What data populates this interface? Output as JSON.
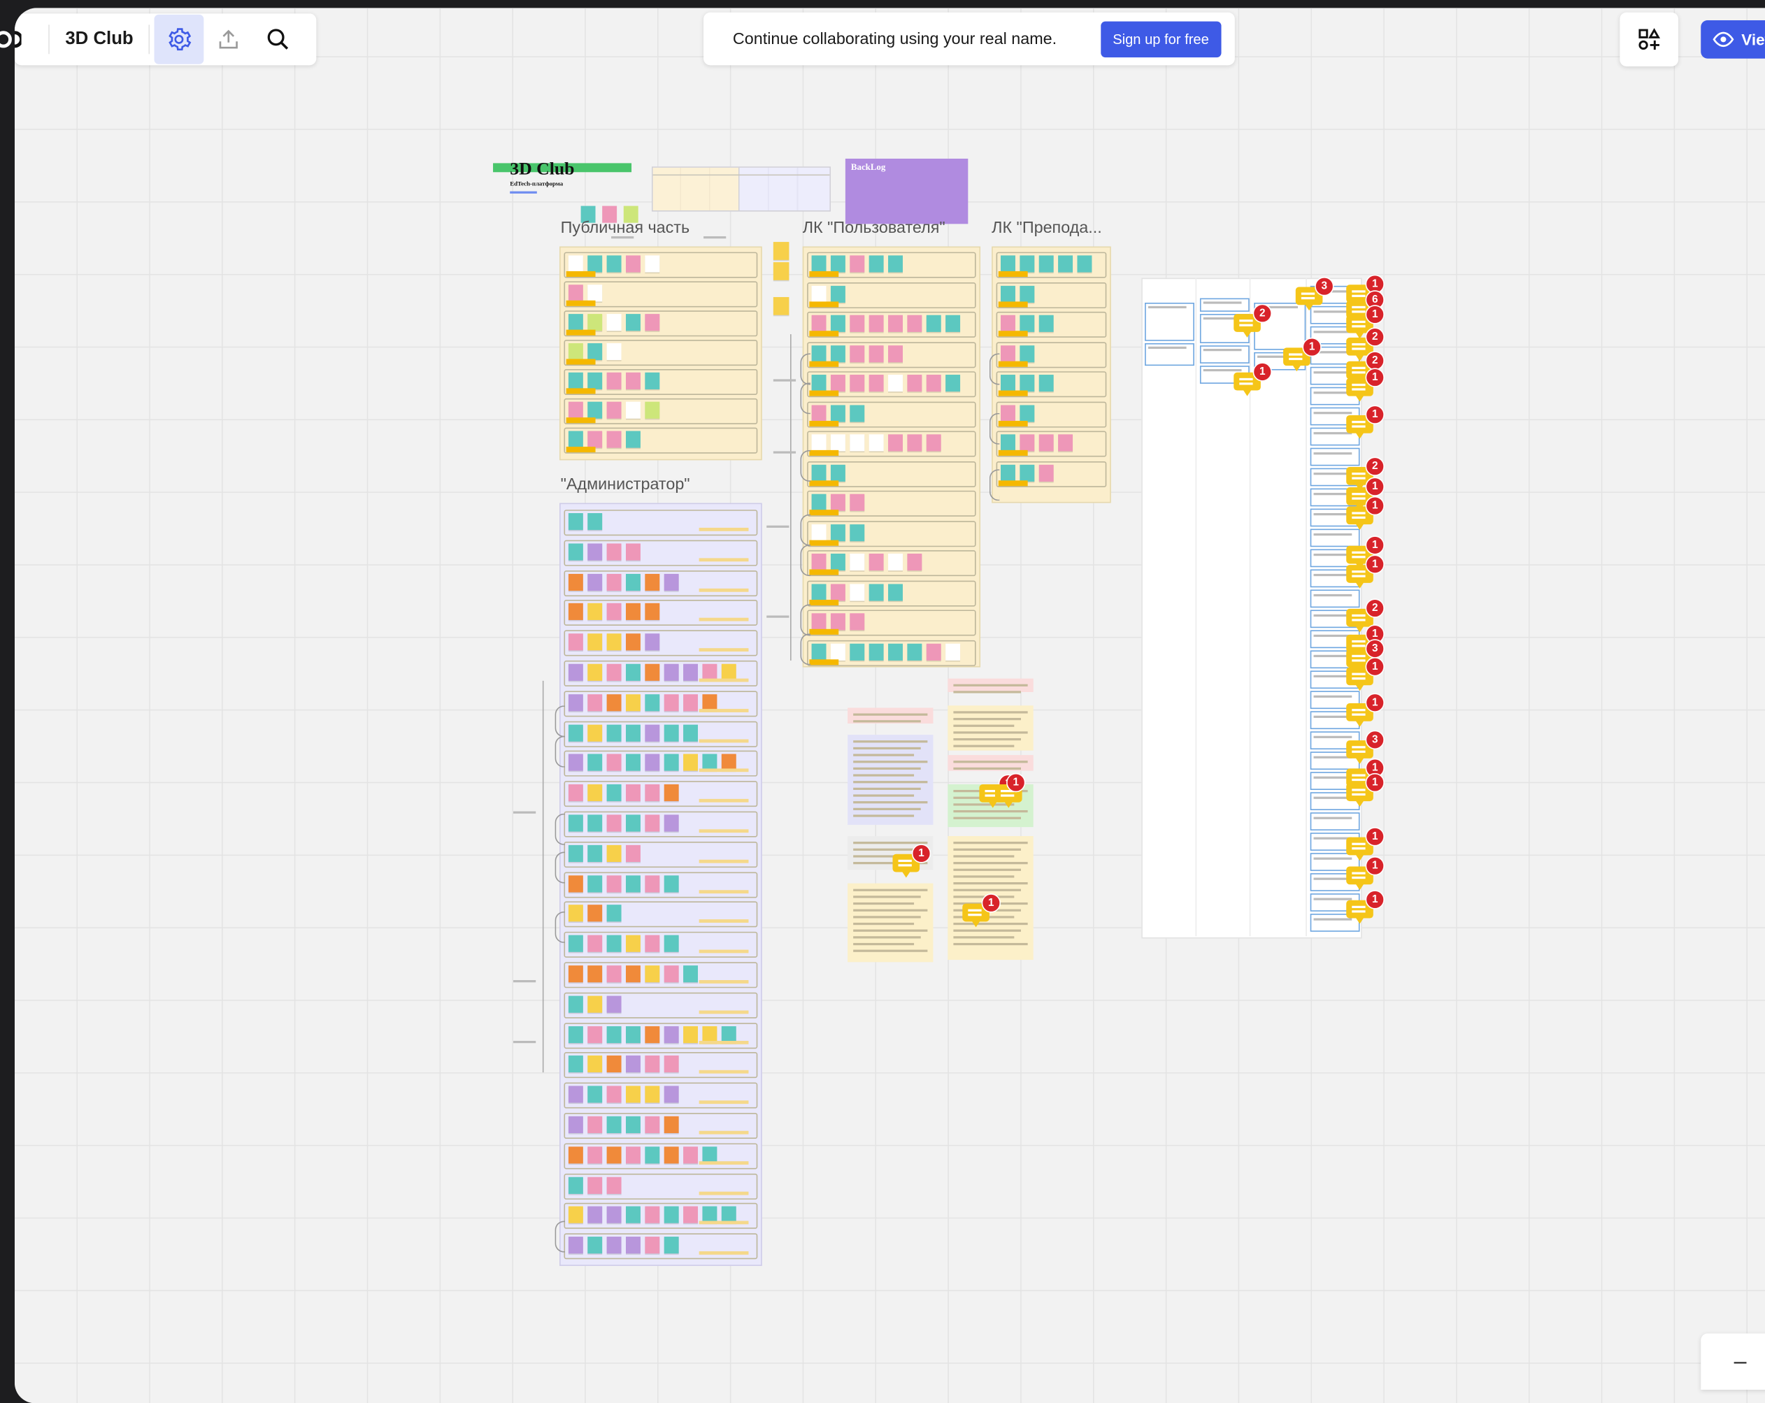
{
  "app": {
    "board_name": "3D Club",
    "banner_text": "Continue collaborating using your real name.",
    "signup_label": "Sign up for free",
    "view_label": "View",
    "zoom_out_label": "–"
  },
  "toolbar": {
    "icons": [
      "board-menu-icon",
      "settings-icon",
      "export-icon",
      "search-icon"
    ]
  },
  "canvas": {
    "logo_title": "3D Club",
    "logo_subtitle": "EdTech-платформа",
    "backlog_label": "BackLog",
    "sections": [
      {
        "title": "Публичная часть"
      },
      {
        "title": "ЛК \"Пользователя\""
      },
      {
        "title": "ЛК \"Препода..."
      },
      {
        "title": "\"Администратор\""
      }
    ],
    "comment_counts": [
      "3",
      "2",
      "1",
      "1",
      "1",
      "6",
      "1",
      "2",
      "2",
      "1",
      "1",
      "2",
      "1",
      "1",
      "1",
      "1",
      "2",
      "1",
      "3",
      "1",
      "1",
      "3",
      "1",
      "1",
      "1",
      "1",
      "1",
      "1",
      "1",
      "1"
    ]
  },
  "colors": {
    "accent": "#3e5ae6",
    "sticky_teal": "#5cc8c0",
    "sticky_pink": "#ee97b8",
    "sticky_yellow": "#f7d04a",
    "sticky_purple": "#b896dc",
    "section_yellow": "#fbeecc",
    "section_lavender": "#e9e8fb",
    "comment_yellow": "#f5c518",
    "badge_red": "#d8232a"
  }
}
